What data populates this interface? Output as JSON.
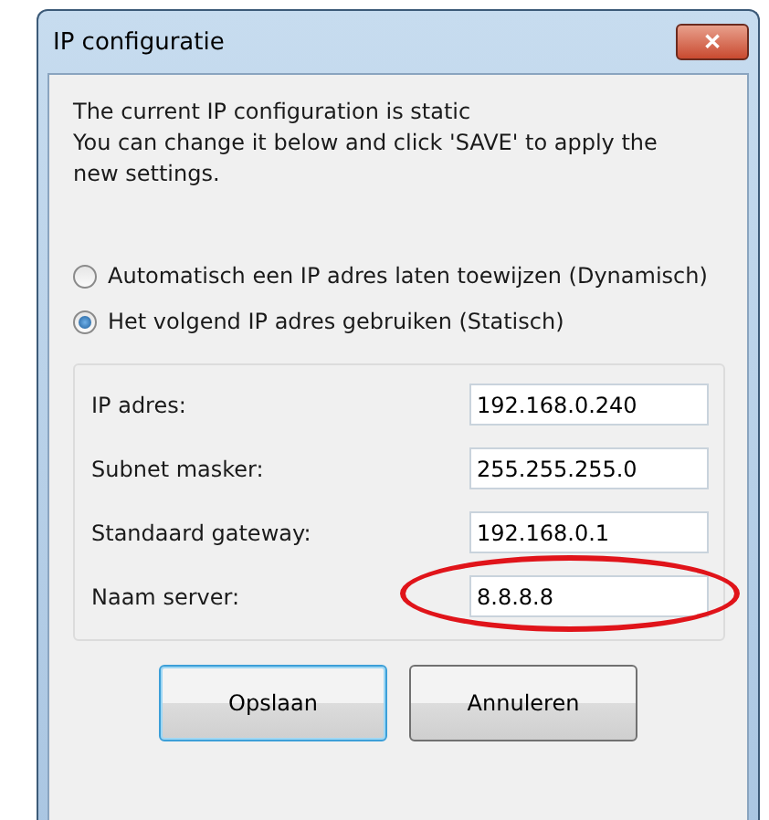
{
  "window": {
    "title": "IP configuratie",
    "close": "✕"
  },
  "message": [
    "The current IP configuration is static",
    "You can change it below and click 'SAVE' to apply the new settings."
  ],
  "modes": [
    {
      "label": "Automatisch een IP adres laten toewijzen (Dynamisch)",
      "selected": false
    },
    {
      "label": "Het volgend IP adres gebruiken (Statisch)",
      "selected": true
    }
  ],
  "fields": [
    {
      "label": "IP adres:",
      "value": "192.168.0.240",
      "highlighted": false
    },
    {
      "label": "Subnet masker:",
      "value": "255.255.255.0",
      "highlighted": false
    },
    {
      "label": "Standaard gateway:",
      "value": "192.168.0.1",
      "highlighted": false
    },
    {
      "label": "Naam server:",
      "value": "8.8.8.8",
      "highlighted": true
    }
  ],
  "buttons": [
    {
      "label": "Opslaan",
      "default": true
    },
    {
      "label": "Annuleren",
      "default": false
    }
  ]
}
